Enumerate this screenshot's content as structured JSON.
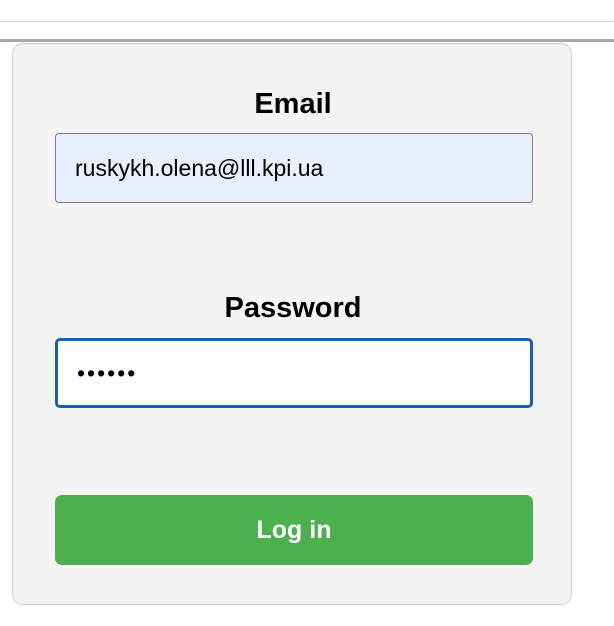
{
  "login_form": {
    "email_label": "Email",
    "email_value": "ruskykh.olena@lll.kpi.ua",
    "password_label": "Password",
    "password_value": "••••••",
    "login_button_label": "Log in"
  },
  "colors": {
    "page_background": "#ffffff",
    "card_background": "#f4f4f4",
    "email_input_background": "#e8f0fe",
    "password_focus_border": "#1a5fb4",
    "login_button_background": "#4caf50",
    "login_button_text": "#ffffff"
  }
}
